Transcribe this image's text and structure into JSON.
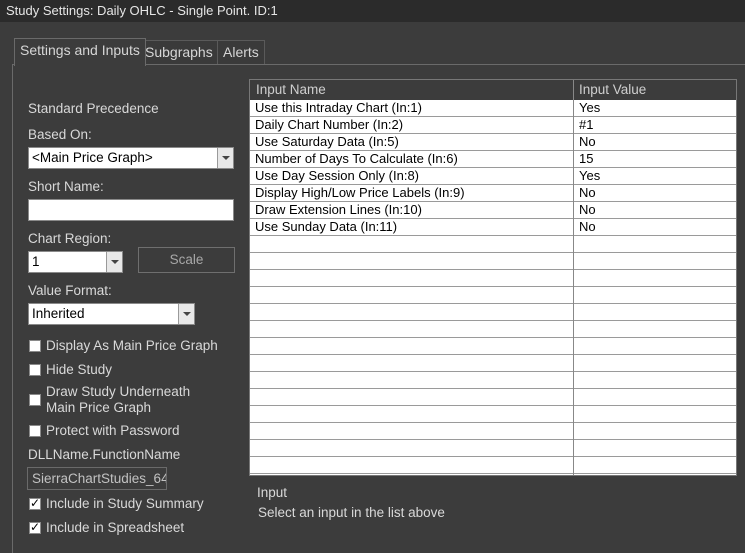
{
  "window": {
    "title": "Study Settings: Daily OHLC - Single Point. ID:1"
  },
  "tabs": [
    {
      "label": "Settings and Inputs",
      "active": true
    },
    {
      "label": "Subgraphs",
      "active": false
    },
    {
      "label": "Alerts",
      "active": false
    }
  ],
  "left": {
    "standard_precedence": "Standard Precedence",
    "based_on_label": "Based On:",
    "based_on_value": "<Main Price Graph>",
    "short_name_label": "Short Name:",
    "short_name_value": "",
    "chart_region_label": "Chart Region:",
    "chart_region_value": "1",
    "scale_button": "Scale",
    "value_format_label": "Value Format:",
    "value_format_value": "Inherited",
    "checkboxes": [
      {
        "label": "Display As Main Price Graph",
        "checked": false
      },
      {
        "label": "Hide Study",
        "checked": false
      },
      {
        "label": "Draw Study Underneath",
        "label2": "Main Price Graph",
        "checked": false
      },
      {
        "label": "Protect with Password",
        "checked": false
      }
    ],
    "dll_label": "DLLName.FunctionName",
    "dll_value": "SierraChartStudies_64",
    "bottom_checkboxes": [
      {
        "label": "Include in Study Summary",
        "checked": true
      },
      {
        "label": "Include in Spreadsheet",
        "checked": true
      }
    ]
  },
  "inputs_grid": {
    "col_name": "Input Name",
    "col_value": "Input Value",
    "rows": [
      {
        "name": "Use this Intraday Chart  (In:1)",
        "value": "Yes"
      },
      {
        "name": "Daily Chart Number  (In:2)",
        "value": "#1"
      },
      {
        "name": "Use Saturday Data  (In:5)",
        "value": "No"
      },
      {
        "name": "Number of Days To Calculate  (In:6)",
        "value": "15"
      },
      {
        "name": "Use Day Session Only  (In:8)",
        "value": "Yes"
      },
      {
        "name": "Display High/Low Price Labels  (In:9)",
        "value": "No"
      },
      {
        "name": "Draw Extension Lines  (In:10)",
        "value": "No"
      },
      {
        "name": "Use Sunday Data  (In:11)",
        "value": "No"
      }
    ]
  },
  "input_info": {
    "title": "Input",
    "description": "Select an input in the list above"
  }
}
